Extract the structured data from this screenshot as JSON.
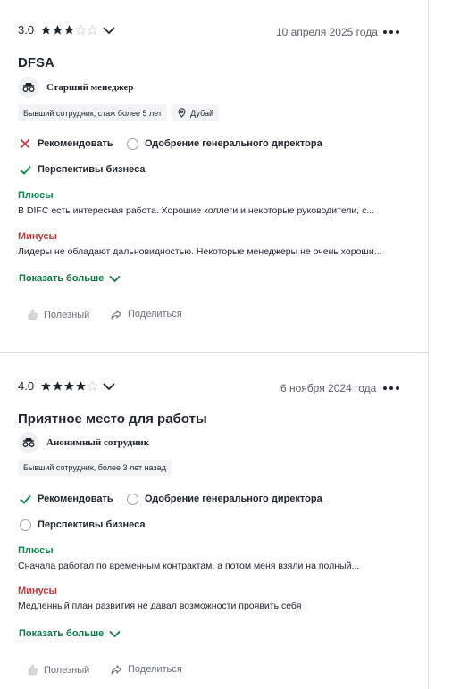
{
  "colors": {
    "pros": "#0a8a4a",
    "cons": "#c33a3a",
    "accent": "#0a7a45",
    "star": "#20262e"
  },
  "reviews": [
    {
      "rating": "3.0",
      "stars": 3,
      "date": "10 апреля 2025 года",
      "title": "DFSA",
      "role": "Старший менеджер",
      "role_icon": "anonymous-glasses-icon",
      "tags": [
        "Бывший сотрудник, стаж более 5 лет"
      ],
      "location": "Дубай",
      "recommend": {
        "label": "Рекомендовать",
        "state": "negative",
        "icon": "cross-icon"
      },
      "ceo": {
        "label": "Одобрение генерального директора",
        "state": "neutral",
        "icon": "circle-icon"
      },
      "outlook": {
        "label": "Перспективы бизнеса",
        "state": "positive",
        "icon": "check-icon"
      },
      "pros_label": "Плюсы",
      "pros_text": "В DIFC есть интересная работа. Хорошие коллеги и некоторые руководители, с...",
      "cons_label": "Минусы",
      "cons_text": "Лидеры не обладают дальновидностью. Некоторые менеджеры не очень хороши...",
      "show_more": "Показать больше",
      "helpful": "Полезный",
      "share": "Поделиться"
    },
    {
      "rating": "4.0",
      "stars": 4,
      "date": "6 ноября 2024 года",
      "title": "Приятное место для работы",
      "role": "Анонимный сотрудник",
      "role_icon": "anonymous-glasses-icon",
      "tags": [
        "Бывший сотрудник, более 3 лет назад"
      ],
      "recommend": {
        "label": "Рекомендовать",
        "state": "positive",
        "icon": "check-icon"
      },
      "ceo": {
        "label": "Одобрение генерального директора",
        "state": "neutral",
        "icon": "circle-icon"
      },
      "outlook": {
        "label": "Перспективы бизнеса",
        "state": "neutral",
        "icon": "circle-icon"
      },
      "pros_label": "Плюсы",
      "pros_text": "Сначала работал по временным контрактам, а потом меня взяли на полный...",
      "cons_label": "Минусы",
      "cons_text": "Медленный план развития не давал возможности проявить себя",
      "show_more": "Показать больше",
      "helpful": "Полезный",
      "share": "Поделиться"
    }
  ]
}
